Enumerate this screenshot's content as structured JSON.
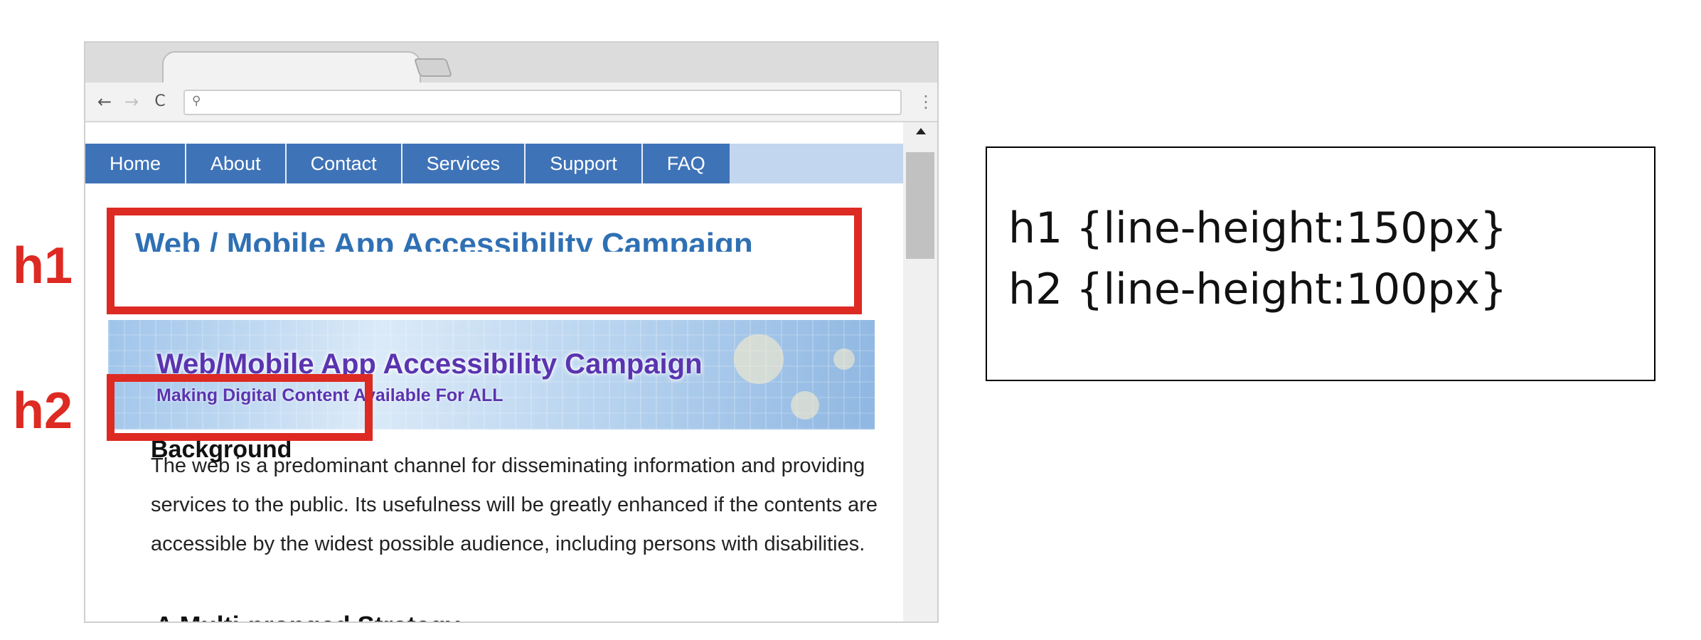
{
  "browser": {
    "address_bar": {
      "value": "",
      "search_icon": "search-icon"
    },
    "nav": {
      "back_icon": "←",
      "forward_icon": "→",
      "reload_icon": "C",
      "menu_icon": "⋮"
    }
  },
  "site_nav": {
    "items": [
      {
        "label": "Home"
      },
      {
        "label": "About"
      },
      {
        "label": "Contact"
      },
      {
        "label": "Services"
      },
      {
        "label": "Support"
      },
      {
        "label": "FAQ"
      }
    ]
  },
  "page": {
    "h1": "Web / Mobile App Accessibility Campaign",
    "banner_title": "Web/Mobile App Accessibility Campaign",
    "banner_subtitle": "Making Digital Content Available For ALL",
    "h2": "Background",
    "paragraph": "The web is a predominant channel for disseminating information and providing services to the public. Its usefulness will be greatly enhanced if the contents are accessible by the widest possible audience, including persons with disabilities.",
    "h3": "A Multi-pronged Strategy"
  },
  "annotations": {
    "h1_label": "h1",
    "h2_label": "h2",
    "color": "#dd2a23"
  },
  "code_box": {
    "lines": [
      "h1 {line-height:150px}",
      "h2 {line-height:100px}"
    ]
  }
}
